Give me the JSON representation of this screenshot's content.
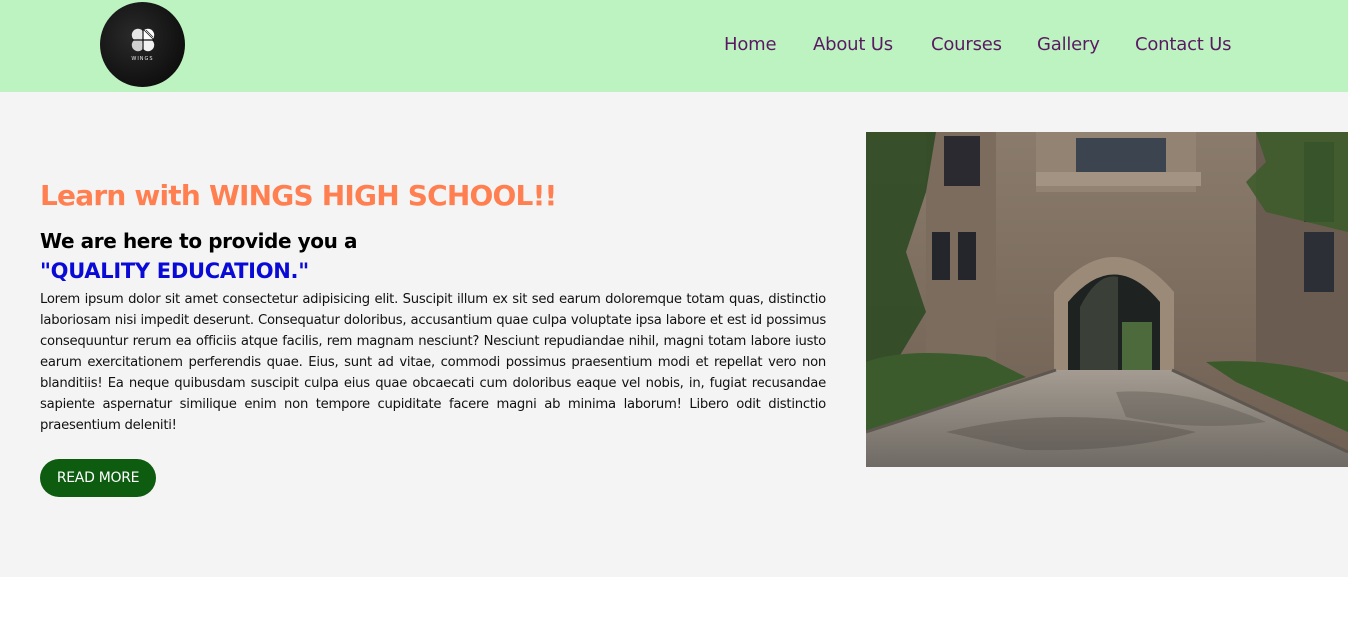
{
  "header": {
    "logo": {
      "text": "WINGS",
      "icon": "wings-logo"
    },
    "nav": [
      {
        "label": "Home"
      },
      {
        "label": "About Us"
      },
      {
        "label": "Courses"
      },
      {
        "label": "Gallery"
      },
      {
        "label": "Contact Us"
      }
    ]
  },
  "hero": {
    "title": "Learn with WINGS HIGH SCHOOL!!",
    "subtitle": "We are here to provide you a",
    "quote": "\"QUALITY EDUCATION.\"",
    "paragraph": "Lorem ipsum dolor sit amet consectetur adipisicing elit. Suscipit illum ex sit sed earum doloremque totam quas, distinctio laboriosam nisi impedit deserunt. Consequatur doloribus, accusantium quae culpa voluptate ipsa labore et est id possimus consequuntur rerum ea officiis atque facilis, rem magnam nesciunt? Nesciunt repudiandae nihil, magni totam labore iusto earum exercitationem perferendis quae. Eius, sunt ad vitae, commodi possimus praesentium modi et repellat vero non blanditiis! Ea neque quibusdam suscipit culpa eius quae obcaecati cum doloribus eaque vel nobis, in, fugiat recusandae sapiente aspernatur similique enim non tempore cupiditate facere magni ab minima laborum! Libero odit distinctio praesentium deleniti!",
    "button_label": "READ MORE",
    "image": "school-building-archway-photo"
  },
  "colors": {
    "navbar_bg": "#bdf3c0",
    "nav_link": "#5a1a63",
    "title": "#ff7f50",
    "quote": "#0a0ad6",
    "button_bg": "#0e5c10",
    "hero_bg": "#f4f4f4"
  }
}
